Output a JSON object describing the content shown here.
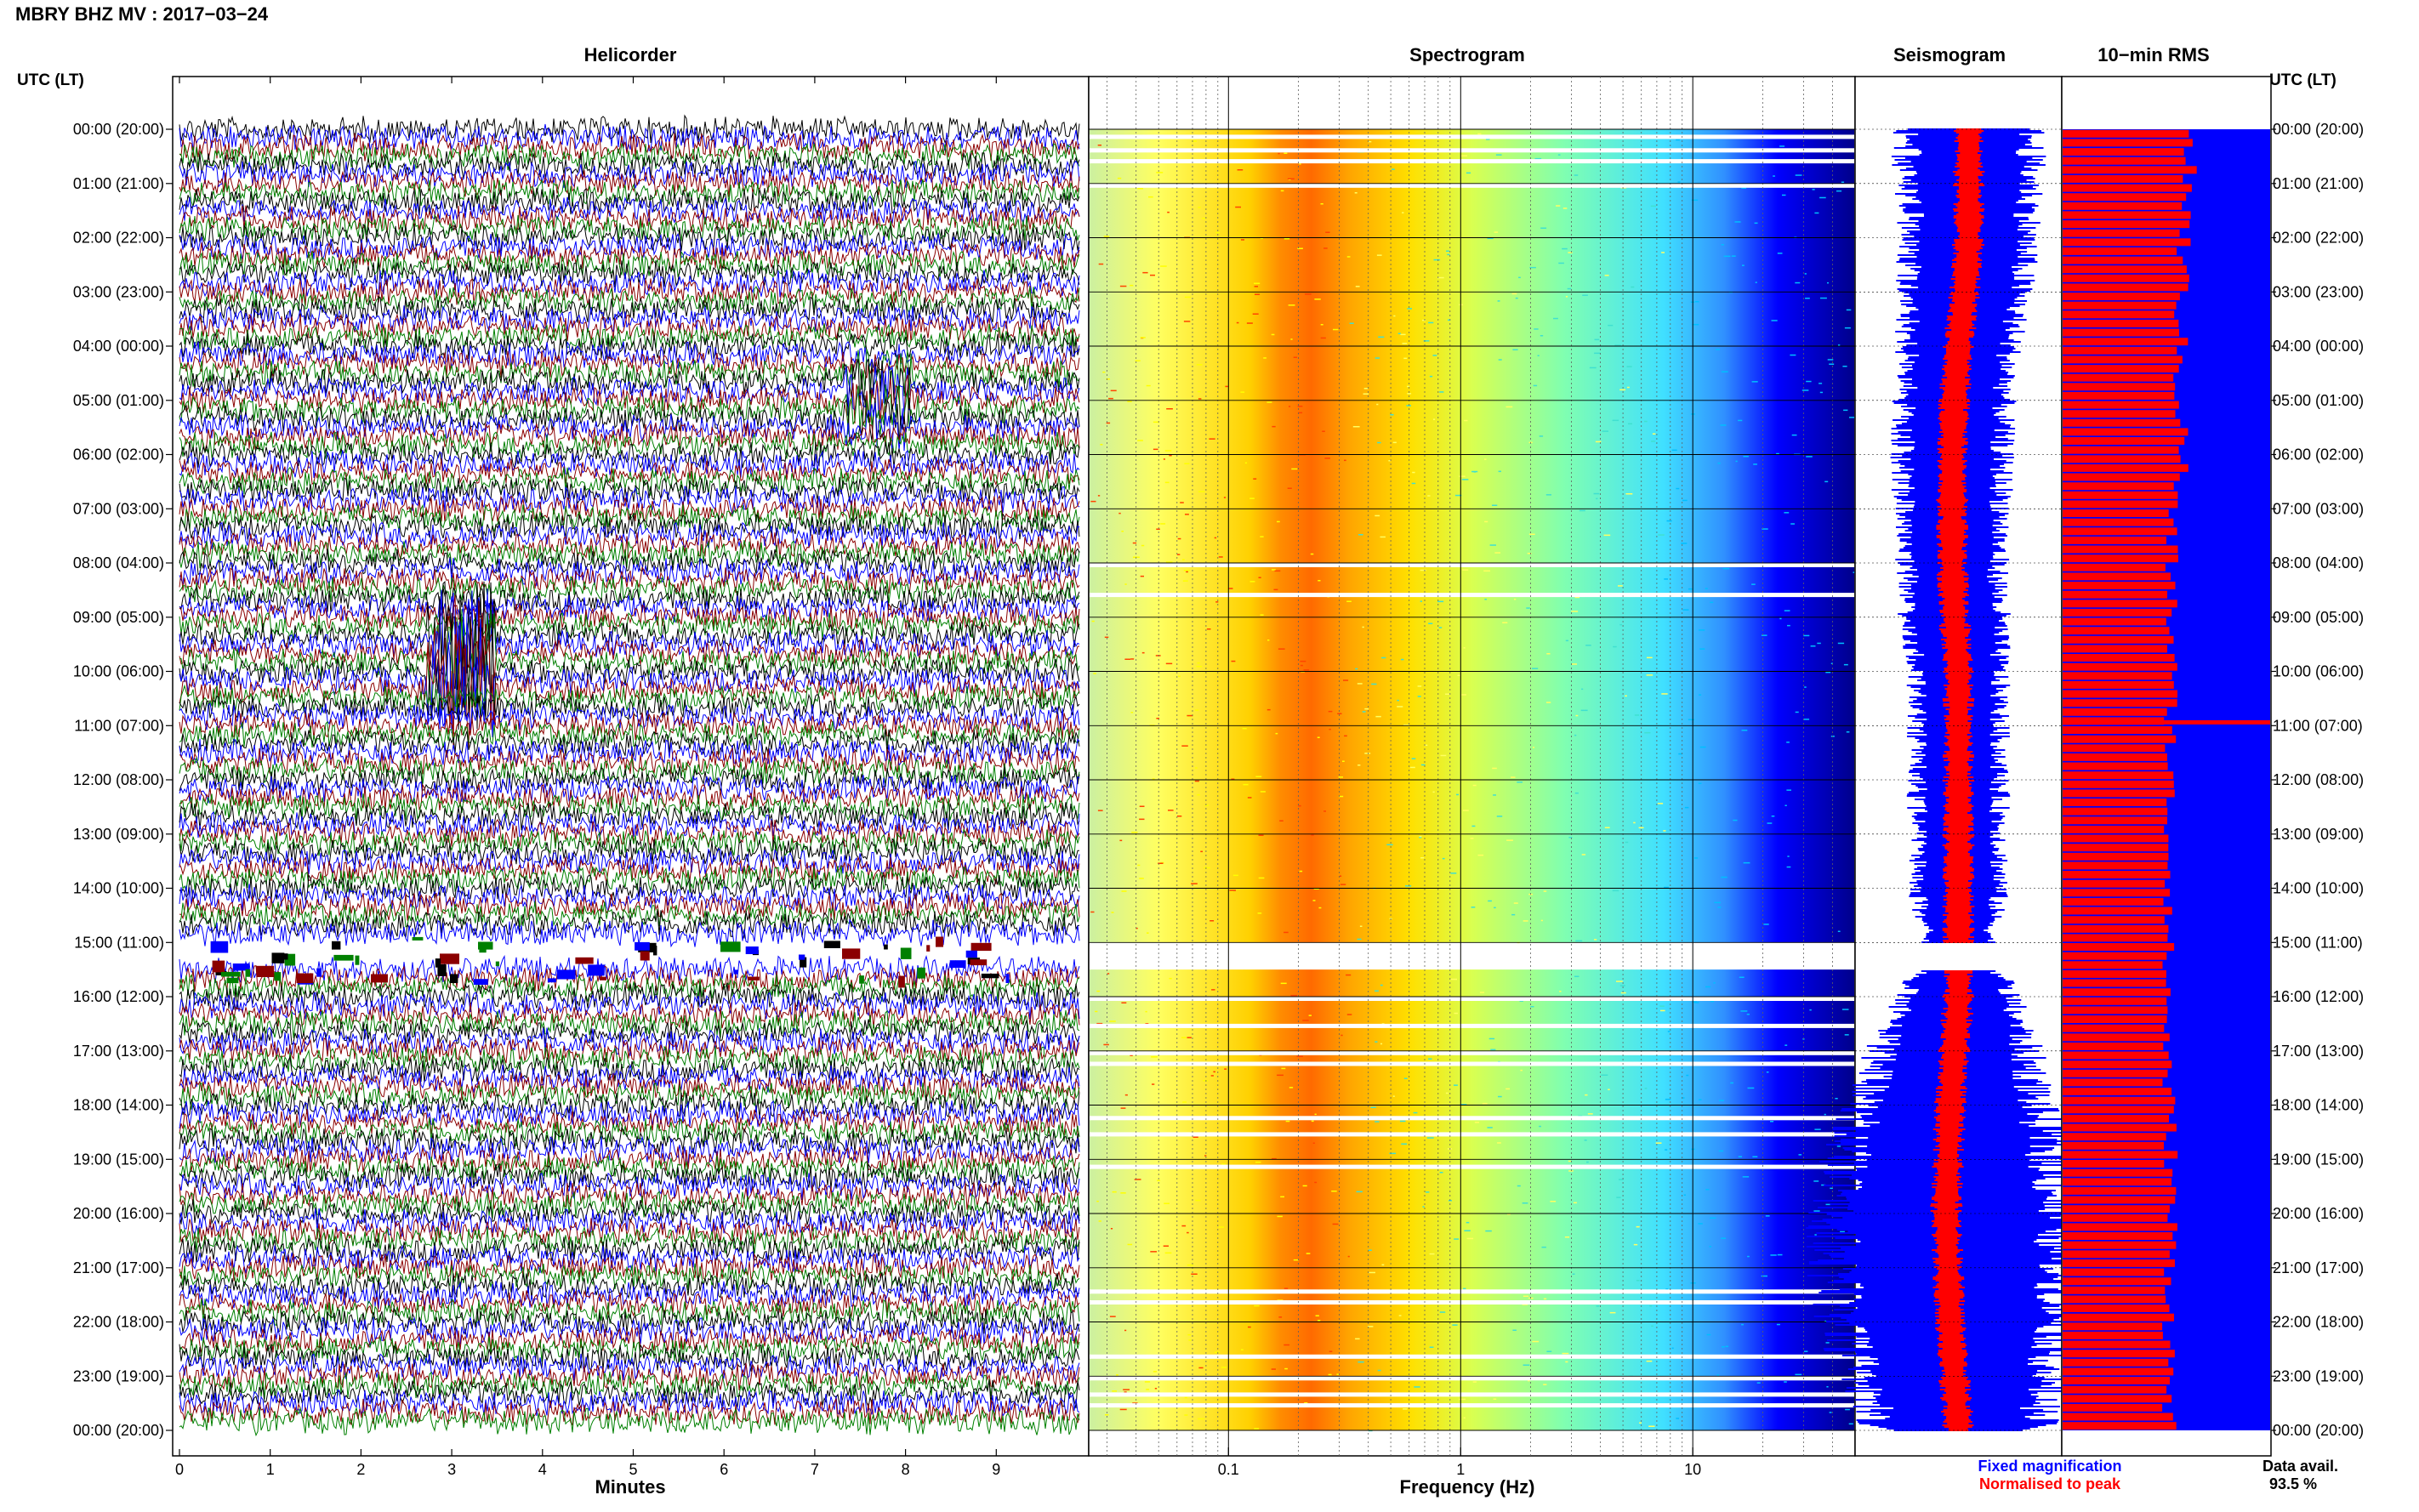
{
  "page": {
    "title": "MBRY BHZ MV : 2017−03−24",
    "panel_titles": [
      "Helicorder",
      "Spectrogram",
      "Seismogram",
      "10−min RMS"
    ],
    "left_axis_header": "UTC (LT)",
    "right_axis_header": "UTC (LT)",
    "legend": {
      "fixed": "Fixed magnification",
      "normalised": "Normalised to peak",
      "fixed_color": "#0000ff",
      "normalised_color": "#ff0000"
    },
    "data_avail_label": "Data avail.",
    "data_avail_value": "93.5 %"
  },
  "chart_data": [
    {
      "type": "line",
      "title": "Helicorder",
      "xlabel": "Minutes",
      "x_ticks": [
        "0",
        "1",
        "2",
        "3",
        "4",
        "5",
        "6",
        "7",
        "8",
        "9"
      ],
      "xlim": [
        0,
        10
      ],
      "row_labels": [
        "00:00 (20:00)",
        "01:00 (21:00)",
        "02:00 (22:00)",
        "03:00 (23:00)",
        "04:00 (00:00)",
        "05:00 (01:00)",
        "06:00 (02:00)",
        "07:00 (03:00)",
        "08:00 (04:00)",
        "09:00 (05:00)",
        "10:00 (06:00)",
        "11:00 (07:00)",
        "12:00 (08:00)",
        "13:00 (09:00)",
        "14:00 (10:00)",
        "15:00 (11:00)",
        "16:00 (12:00)",
        "17:00 (13:00)",
        "18:00 (14:00)",
        "19:00 (15:00)",
        "20:00 (16:00)",
        "21:00 (17:00)",
        "22:00 (18:00)",
        "23:00 (19:00)",
        "00:00 (20:00)"
      ],
      "trace_colors": [
        "#000000",
        "#0000ff",
        "#8b0000",
        "#008000"
      ],
      "gap_hours": [
        15.0,
        15.5
      ],
      "events": [
        {
          "hour": 9.8,
          "minute": 3.1,
          "note": "large amplitude burst"
        },
        {
          "hour": 5.0,
          "minute": 7.7,
          "note": "spike"
        }
      ]
    },
    {
      "type": "heatmap",
      "title": "Spectrogram",
      "xlabel": "Frequency (Hz)",
      "x_scale": "log",
      "xlim": [
        0.025,
        50
      ],
      "x_ticks": [
        "0.1",
        "1",
        "10"
      ],
      "peak_band_hz": [
        0.17,
        0.35
      ],
      "colormap": [
        "#00008b",
        "#0000ff",
        "#00bfff",
        "#40e0d0",
        "#adff2f",
        "#ffff00",
        "#ffa500",
        "#ff4500"
      ],
      "gap_hours": [
        15.0,
        15.5
      ]
    },
    {
      "type": "line",
      "title": "Seismogram",
      "series": [
        {
          "name": "Fixed magnification",
          "color": "#0000ff"
        },
        {
          "name": "Normalised to peak",
          "color": "#ff0000"
        }
      ],
      "fixed_half_width": [
        0.3,
        0.3,
        0.28,
        0.27,
        0.25,
        0.24,
        0.24,
        0.24,
        0.22,
        0.22,
        0.2,
        0.2,
        0.2,
        0.2,
        0.2,
        0.15,
        0.25,
        0.35,
        0.42,
        0.5,
        0.55,
        0.55,
        0.55,
        0.45,
        0.38
      ],
      "center_offset": [
        0.55,
        0.55,
        0.55,
        0.53,
        0.5,
        0.48,
        0.47,
        0.47,
        0.47,
        0.48,
        0.5,
        0.5,
        0.5,
        0.5,
        0.5,
        0.5,
        0.5,
        0.48,
        0.46,
        0.45,
        0.44,
        0.45,
        0.46,
        0.48,
        0.5
      ],
      "gap_hours": [
        15.0,
        15.5
      ]
    },
    {
      "type": "bar",
      "title": "10−min RMS",
      "orientation": "horizontal",
      "bar_color": "#ff0000",
      "background_color": "#0000ff",
      "hourly_mean_fraction": [
        0.6,
        0.6,
        0.58,
        0.57,
        0.56,
        0.56,
        0.58,
        0.52,
        0.52,
        0.52,
        0.52,
        0.52,
        0.51,
        0.51,
        0.52,
        0.5,
        0.5,
        0.5,
        0.51,
        0.52,
        0.52,
        0.52,
        0.51,
        0.51,
        0.51
      ],
      "spike_hour": 10.9
    }
  ]
}
